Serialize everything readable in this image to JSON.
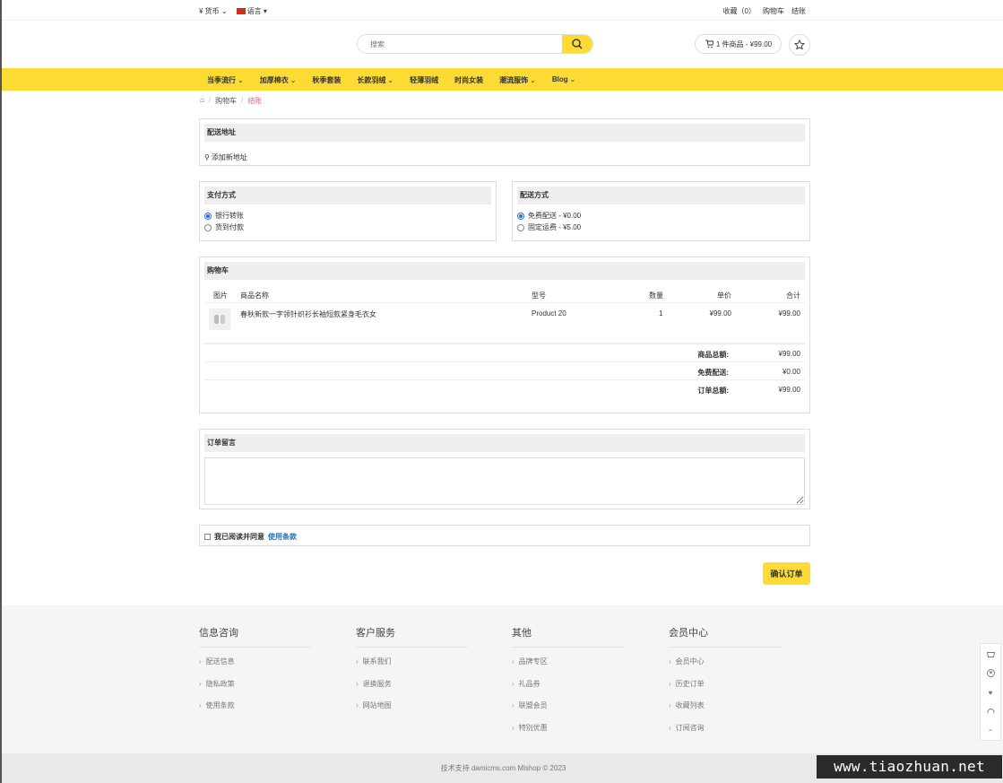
{
  "topbar": {
    "currency": "¥ 货币",
    "language": "语言",
    "favorites": "收藏（0）",
    "cart": "购物车",
    "checkout": "结账"
  },
  "header": {
    "search_placeholder": "搜索",
    "cart_summary": "1 件商品 - ¥99.00"
  },
  "nav": {
    "items": [
      {
        "label": "当季流行",
        "has_dropdown": true
      },
      {
        "label": "加厚棉衣",
        "has_dropdown": true
      },
      {
        "label": "秋季套装",
        "has_dropdown": false
      },
      {
        "label": "长款羽绒",
        "has_dropdown": true
      },
      {
        "label": "轻薄羽绒",
        "has_dropdown": false
      },
      {
        "label": "时尚女装",
        "has_dropdown": false
      },
      {
        "label": "潮流服饰",
        "has_dropdown": true
      },
      {
        "label": "Blog",
        "has_dropdown": true
      }
    ]
  },
  "breadcrumb": {
    "cart": "购物车",
    "current": "结账"
  },
  "shipping_address": {
    "title": "配送地址",
    "add_new": "添加新地址"
  },
  "payment": {
    "title": "支付方式",
    "options": [
      {
        "label": "银行转账",
        "selected": true
      },
      {
        "label": "货到付款",
        "selected": false
      }
    ]
  },
  "delivery": {
    "title": "配送方式",
    "options": [
      {
        "label": "免费配送 - ¥0.00",
        "selected": true
      },
      {
        "label": "固定运费 - ¥5.00",
        "selected": false
      }
    ]
  },
  "cart": {
    "title": "购物车",
    "columns": {
      "image": "图片",
      "name": "商品名称",
      "model": "型号",
      "qty": "数量",
      "price": "单价",
      "total": "合计"
    },
    "rows": [
      {
        "name": "春秋新款一字领针织衫长袖短款紧身毛衣女",
        "model": "Product 20",
        "qty": "1",
        "price": "¥99.00",
        "total": "¥99.00"
      }
    ],
    "totals": [
      {
        "label": "商品总额:",
        "value": "¥99.00"
      },
      {
        "label": "免费配送:",
        "value": "¥0.00"
      },
      {
        "label": "订单总额:",
        "value": "¥99.00"
      }
    ]
  },
  "order_note": {
    "title": "订单留言"
  },
  "agree": {
    "text": "我已阅读并同意",
    "link": "使用条款"
  },
  "confirm_label": "确认订单",
  "footer": {
    "columns": [
      {
        "title": "信息咨询",
        "links": [
          "配送信息",
          "隐私政策",
          "使用条款"
        ]
      },
      {
        "title": "客户服务",
        "links": [
          "联系我们",
          "退换服务",
          "网站地图"
        ]
      },
      {
        "title": "其他",
        "links": [
          "品牌专区",
          "礼品券",
          "联盟会员",
          "特别优惠"
        ]
      },
      {
        "title": "会员中心",
        "links": [
          "会员中心",
          "历史订单",
          "收藏列表",
          "订阅咨询"
        ]
      }
    ],
    "copyright": "技术支持 damicms.com Mishop © 2023"
  },
  "watermark": "www.tiaozhuan.net",
  "colors": {
    "accent": "#fddb35",
    "link": "#1e6fb7",
    "breadcrumb_active": "#e85d8d"
  }
}
